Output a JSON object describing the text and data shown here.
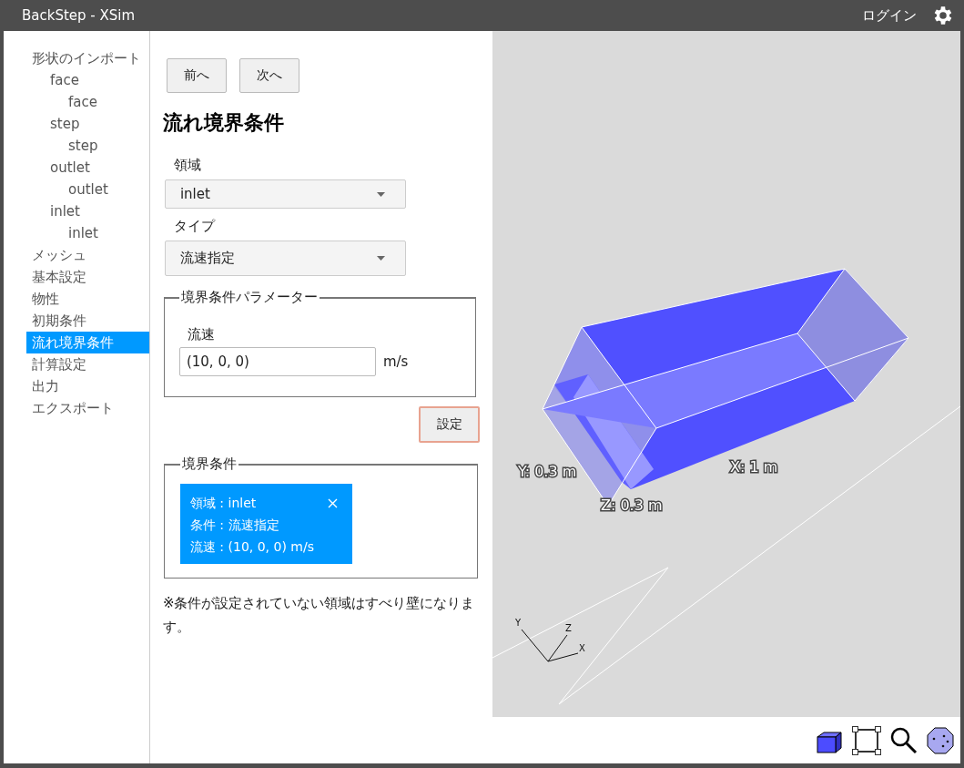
{
  "window": {
    "title": "BackStep - XSim",
    "login": "ログイン"
  },
  "sidebar": {
    "items": [
      {
        "label": "形状のインポート",
        "selected": false,
        "children": [
          {
            "label": "face",
            "selected": false,
            "children": [
              {
                "label": "face",
                "selected": false
              }
            ]
          },
          {
            "label": "step",
            "selected": false,
            "children": [
              {
                "label": "step",
                "selected": false
              }
            ]
          },
          {
            "label": "outlet",
            "selected": false,
            "children": [
              {
                "label": "outlet",
                "selected": false
              }
            ]
          },
          {
            "label": "inlet",
            "selected": false,
            "children": [
              {
                "label": "inlet",
                "selected": false
              }
            ]
          }
        ]
      },
      {
        "label": "メッシュ",
        "selected": false
      },
      {
        "label": "基本設定",
        "selected": false
      },
      {
        "label": "物性",
        "selected": false
      },
      {
        "label": "初期条件",
        "selected": false
      },
      {
        "label": "流れ境界条件",
        "selected": true
      },
      {
        "label": "計算設定",
        "selected": false
      },
      {
        "label": "出力",
        "selected": false
      },
      {
        "label": "エクスポート",
        "selected": false
      }
    ]
  },
  "nav_buttons": [
    "前へ",
    "次へ"
  ],
  "heading": "流れ境界条件",
  "region_field": {
    "label": "領域",
    "value": "inlet"
  },
  "type_field": {
    "label": "タイプ",
    "value": "流速指定"
  },
  "parameters": {
    "legend": "境界条件パラメーター",
    "velocity_label": "流速",
    "velocity_value": "(10, 0, 0)",
    "unit": "m/s"
  },
  "set_button": "設定",
  "conditions": {
    "legend": "境界条件",
    "items": [
      {
        "lines": [
          "領域 : inlet",
          "条件 : 流速指定",
          "流速 : (10, 0, 0) m/s"
        ]
      }
    ]
  },
  "note": "※条件が設定されていない領域はすべり壁になります。",
  "viewport": {
    "dimension_labels": [
      "Y: 0.3 m",
      "Z: 0.3 m",
      "X: 1 m"
    ],
    "axis_labels": [
      "Y",
      "Z",
      "X"
    ]
  }
}
